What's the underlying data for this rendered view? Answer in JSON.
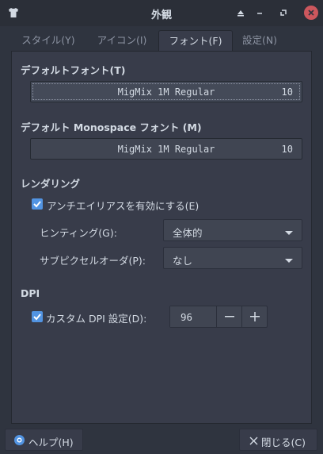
{
  "window": {
    "title": "外観",
    "controls": [
      "shade",
      "minimize",
      "maximize",
      "close"
    ]
  },
  "tabs": [
    {
      "label": "スタイル(Y)",
      "active": false
    },
    {
      "label": "アイコン(I)",
      "active": false
    },
    {
      "label": "フォント(F)",
      "active": true
    },
    {
      "label": "設定(N)",
      "active": false
    }
  ],
  "default_font": {
    "title": "デフォルトフォント(T)",
    "name": "MigMix 1M Regular",
    "size": "10"
  },
  "monospace_font": {
    "title": "デフォルト Monospace フォント (M)",
    "name": "MigMix 1M Regular",
    "size": "10"
  },
  "rendering": {
    "title": "レンダリング",
    "antialias_label": "アンチエイリアスを有効にする(E)",
    "antialias_checked": true,
    "hinting_label": "ヒンティング(G):",
    "hinting_value": "全体的",
    "subpixel_label": "サブピクセルオーダ(P):",
    "subpixel_value": "なし"
  },
  "dpi": {
    "title": "DPI",
    "custom_label": "カスタム DPI 設定(D):",
    "custom_checked": true,
    "value": "96"
  },
  "footer": {
    "help_label": "ヘルプ(H)",
    "close_label": "閉じる(C)"
  },
  "colors": {
    "background": "#2f343f",
    "panel": "#383c4a",
    "accent": "#5294e2",
    "close": "#cc575d"
  }
}
